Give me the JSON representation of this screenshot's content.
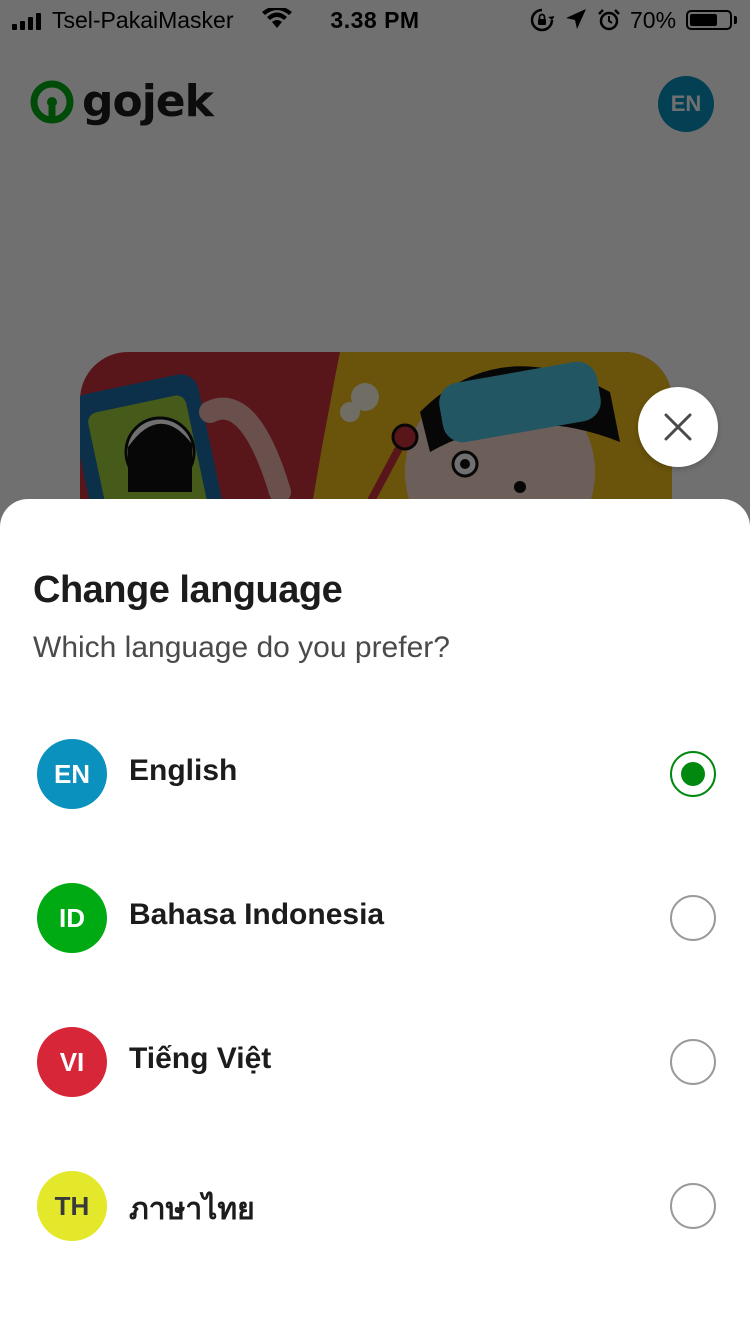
{
  "status_bar": {
    "carrier": "Tsel-PakaiMasker",
    "time": "3.38 PM",
    "battery_percent": "70%",
    "battery_level": 0.7,
    "icons": [
      "signal-icon",
      "wifi-icon",
      "rotation-lock-icon",
      "location-arrow-icon",
      "alarm-icon",
      "battery-icon"
    ]
  },
  "header": {
    "logo_text": "gojek",
    "current_language_badge": "EN"
  },
  "colors": {
    "brand_green": "#00880f",
    "en": "#0b91be",
    "id": "#00aa13",
    "vi": "#d72638",
    "th": "#e4e82a"
  },
  "sheet": {
    "title": "Change language",
    "subtitle": "Which language do you prefer?",
    "close_icon": "close-icon",
    "languages": [
      {
        "code": "EN",
        "name": "English",
        "selected": true
      },
      {
        "code": "ID",
        "name": "Bahasa Indonesia",
        "selected": false
      },
      {
        "code": "VI",
        "name": "Tiếng Việt",
        "selected": false
      },
      {
        "code": "TH",
        "name": "ภาษาไทย",
        "selected": false
      }
    ]
  }
}
